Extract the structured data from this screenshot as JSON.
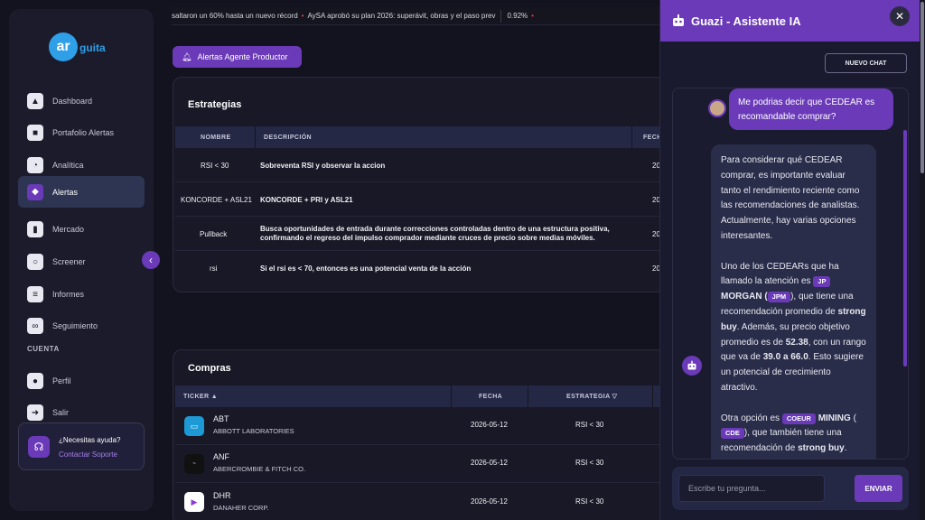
{
  "brand": {
    "logo_mark": "ar",
    "logo_text": "guita"
  },
  "sidebar": {
    "items": [
      {
        "label": "Dashboard",
        "icon": "chart-icon"
      },
      {
        "label": "Portafolio Alertas",
        "icon": "briefcase-icon"
      },
      {
        "label": "Analítica",
        "icon": "pie-icon"
      },
      {
        "label": "Alertas",
        "icon": "bell-icon",
        "active": true
      },
      {
        "label": "Mercado",
        "icon": "bar-chart-icon"
      },
      {
        "label": "Screener",
        "icon": "search-icon"
      },
      {
        "label": "Informes",
        "icon": "document-icon"
      },
      {
        "label": "Seguimiento",
        "icon": "binoculars-icon"
      }
    ],
    "section_label": "CUENTA",
    "account_items": [
      {
        "label": "Perfil",
        "icon": "user-icon"
      },
      {
        "label": "Salir",
        "icon": "logout-icon"
      }
    ],
    "help": {
      "title": "¿Necesitas ayuda?",
      "link": "Contactar Soporte"
    }
  },
  "ticker": {
    "text1": "saltaron un 60% hasta un nuevo récord",
    "text2": "AySA aprobó su plan 2026: superávit, obras y el paso prev",
    "value": "0.92%"
  },
  "alert_button": "Alertas Agente Productor",
  "strategies": {
    "title": "Estrategias",
    "headers": [
      "NOMBRE",
      "DESCRIPCIÓN",
      "FECH"
    ],
    "rows": [
      {
        "name": "RSI < 30",
        "desc": "Sobreventa RSI y observar la accion",
        "date": "20"
      },
      {
        "name": "KONCORDE + ASL21",
        "desc": "KONCORDE + PRI y ASL21",
        "date": "20"
      },
      {
        "name": "Pullback",
        "desc": "Busca oportunidades de entrada durante correcciones controladas dentro de una estructura positiva, confirmando el regreso del impulso comprador mediante cruces de precio sobre medias móviles.",
        "date": "20"
      },
      {
        "name": "rsi",
        "desc": "Si el rsi es < 70, entonces es una potencial venta de la acción",
        "date": "20"
      }
    ]
  },
  "purchases": {
    "title": "Compras",
    "headers": [
      "TICKER ▲",
      "FECHA",
      "ESTRATEGIA ▽"
    ],
    "rows": [
      {
        "ticker": "ABT",
        "company": "ABBOTT LABORATORIES",
        "date": "2026-05-12",
        "strategy": "RSI < 30",
        "logo_color": "#1d9ad6",
        "logo_glyph": "▭"
      },
      {
        "ticker": "ANF",
        "company": "ABERCROMBIE & FITCH CO.",
        "date": "2026-05-12",
        "strategy": "RSI < 30",
        "logo_color": "#111111",
        "logo_glyph": "~"
      },
      {
        "ticker": "DHR",
        "company": "DANAHER CORP.",
        "date": "2026-05-12",
        "strategy": "RSI < 30",
        "logo_color": "#ffffff",
        "logo_glyph": "▶"
      }
    ]
  },
  "chat": {
    "title": "Guazi - Asistente IA",
    "new_chat": "NUEVO CHAT",
    "user_message": "Me podrias decir que CEDEAR es recomandable comprar?",
    "bot": {
      "p1": "Para considerar qué CEDEAR comprar, es importante evaluar tanto el rendimiento reciente como las recomendaciones de analistas. Actualmente, hay varias opciones interesantes.",
      "p2_a": "Uno de los CEDEARs que ha llamado la atención es",
      "chip_jp": "JP",
      "p2_morgan": "MORGAN (",
      "chip_jpm": "JPM",
      "p2_b": "), que tiene una recomendación promedio de",
      "p2_strong": "strong buy",
      "p2_c": ". Además, su precio objetivo promedio es de",
      "p2_price": "52.38",
      "p2_d": ", con un rango que va de",
      "p2_range": "39.0 a 66.0",
      "p2_e": ". Esto sugiere un potencial de crecimiento atractivo.",
      "p3_a": "Otra opción es",
      "chip_coeur": "COEUR",
      "p3_mining": "MINING",
      "p3_paren": "(",
      "chip_cde": "CDE",
      "p3_b": "), que también tiene una recomendación de",
      "p3_strong": "strong buy",
      "p3_c": "."
    },
    "input_placeholder": "Escribe tu pregunta...",
    "send": "ENVIAR"
  },
  "colors": {
    "accent": "#6a3ab8",
    "background": "#13131f",
    "brand": "#2f9fe8"
  }
}
